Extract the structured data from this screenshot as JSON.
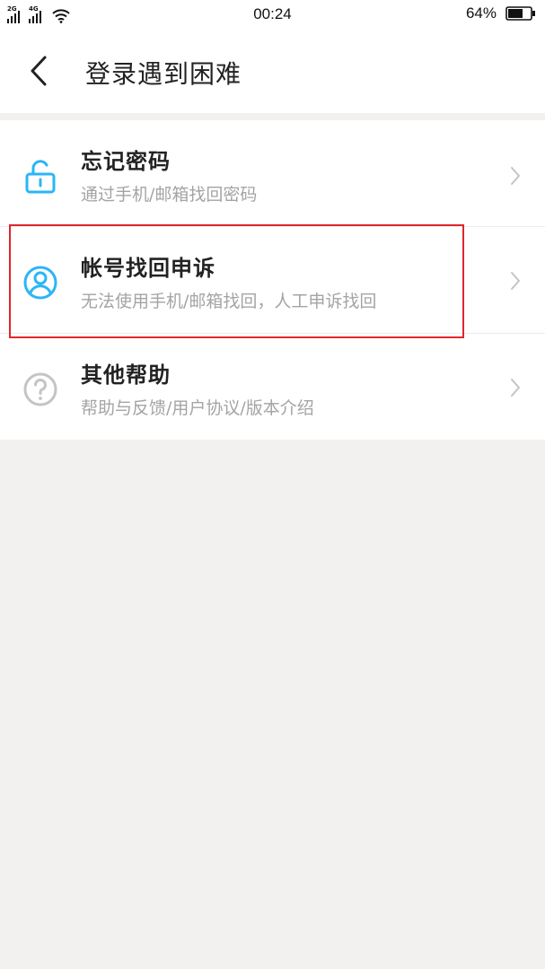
{
  "status_bar": {
    "network_1": "2G",
    "network_2": "4G",
    "time": "00:24",
    "battery": "64%"
  },
  "header": {
    "title": "登录遇到困难",
    "back_icon": "chevron-left-icon"
  },
  "items": [
    {
      "title": "忘记密码",
      "subtitle": "通过手机/邮箱找回密码",
      "icon": "unlock-icon",
      "icon_color": "#29b6f6"
    },
    {
      "title": "帐号找回申诉",
      "subtitle": "无法使用手机/邮箱找回，人工申诉找回",
      "icon": "user-circle-icon",
      "icon_color": "#29b6f6"
    },
    {
      "title": "其他帮助",
      "subtitle": "帮助与反馈/用户协议/版本介绍",
      "icon": "help-circle-icon",
      "icon_color": "#c4c4c4"
    }
  ],
  "colors": {
    "accent": "#29b6f6",
    "highlight_border": "#e0262b",
    "background": "#f2f1f0"
  }
}
